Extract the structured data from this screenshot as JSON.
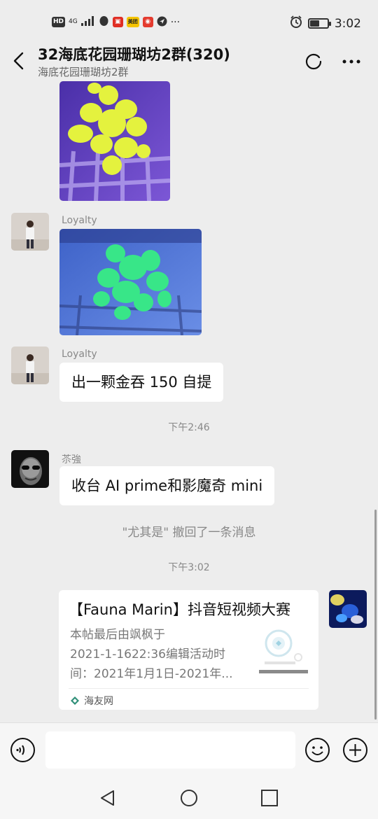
{
  "status_bar": {
    "left_labels": [
      "HD",
      "4G",
      "",
      "",
      "",
      "美团",
      "",
      ""
    ],
    "more": "···",
    "time": "3:02",
    "battery_level": 0.55
  },
  "header": {
    "title": "32海底花园珊瑚坊2群(320)",
    "subtitle": "海底花园珊瑚坊2群"
  },
  "messages": {
    "m1": {
      "sender": "Loyalty",
      "type": "image"
    },
    "m2": {
      "sender": "Loyalty",
      "text": "出一颗金吞 150 自提"
    },
    "time1": "下午2:46",
    "m3": {
      "sender": "苶強",
      "text": "收台 AI prime和影魔奇 mini"
    },
    "recall": "\"尤其是\" 撤回了一条消息",
    "time2": "下午3:02",
    "card": {
      "title": "【Fauna Marin】抖音短视频大赛",
      "desc_line1": "本帖最后由飒枫于",
      "desc_line2": "2021-1-1622:36编辑活动时",
      "desc_line3": "间：2021年1月1日-2021年...",
      "source": "海友网"
    }
  },
  "input": {
    "placeholder": ""
  },
  "icons": {
    "back": "back-arrow-icon",
    "refresh": "refresh-icon",
    "more": "more-icon",
    "voice": "voice-icon",
    "emoji": "emoji-icon",
    "plus": "plus-icon"
  },
  "colors": {
    "background": "#ededed",
    "bubble": "#ffffff",
    "text": "#111111",
    "meta": "#888888"
  }
}
